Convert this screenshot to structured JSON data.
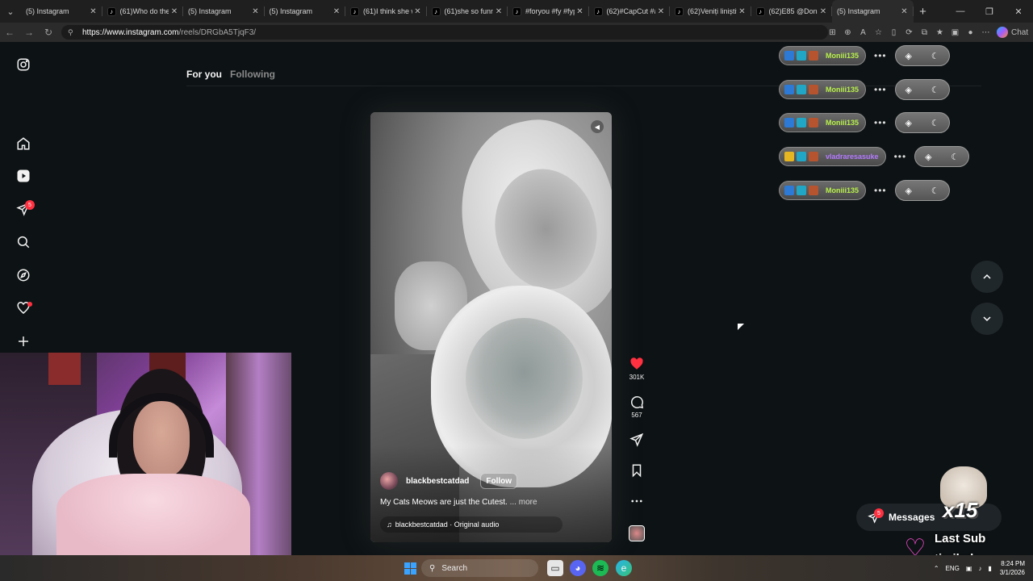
{
  "browser": {
    "tabs": [
      {
        "icon": "instagram-icon",
        "title": "(5) Instagram",
        "active": false
      },
      {
        "icon": "tiktok-icon",
        "title": "(61)Who do they",
        "active": false
      },
      {
        "icon": "instagram-icon",
        "title": "(5) Instagram",
        "active": false
      },
      {
        "icon": "instagram-icon",
        "title": "(5) Instagram",
        "active": false
      },
      {
        "icon": "tiktok-icon",
        "title": "(61)I think she wa",
        "active": false
      },
      {
        "icon": "tiktok-icon",
        "title": "(61)she so funny",
        "active": false
      },
      {
        "icon": "tiktok-icon",
        "title": "#foryou #fy #fyp",
        "active": false
      },
      {
        "icon": "tiktok-icon",
        "title": "(62)#CapCut #ar",
        "active": false
      },
      {
        "icon": "tiktok-icon",
        "title": "(62)Veniți liniștiti",
        "active": false
      },
      {
        "icon": "tiktok-icon",
        "title": "(62)E85 @Don To",
        "active": false
      },
      {
        "icon": "instagram-icon",
        "title": "(5) Instagram",
        "active": true
      }
    ],
    "url_host": "https://www.instagram.com",
    "url_path": "/reels/DRGbA5TjqF3/",
    "chat_label": "Chat"
  },
  "instagram": {
    "notification_badge": "5",
    "feed_tabs": {
      "for_you": "For you",
      "following": "Following"
    },
    "reel": {
      "username": "blackbestcatdad",
      "follow_label": "Follow",
      "caption": "My Cats Meows are just the Cutest.",
      "caption_more": "... more",
      "audio": "blackbestcatdad · Original audio"
    },
    "actions": {
      "likes": "301K",
      "comments": "567"
    },
    "messages_label": "Messages",
    "messages_badge": "5"
  },
  "overlay": {
    "alerts": [
      {
        "name": "Moniii135"
      },
      {
        "name": "Moniii135"
      },
      {
        "name": "Moniii135"
      },
      {
        "name": "vladraresasuke"
      },
      {
        "name": "Moniii135"
      }
    ],
    "combo": "x15",
    "last_sub_title": "Last Sub",
    "last_sub_name": "timihxh"
  },
  "taskbar": {
    "search_label": "Search",
    "language": "ENG",
    "time": "8:24 PM",
    "date": "3/1/2026"
  },
  "colors": {
    "accent_like": "#ff3040",
    "alert_name": "#b8f04c",
    "alert_name_alt": "#b47bff"
  }
}
